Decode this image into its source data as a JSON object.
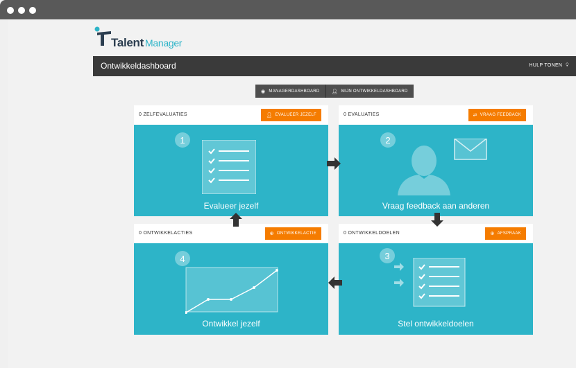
{
  "logo": {
    "brand": "Talent",
    "product": "Manager"
  },
  "header": {
    "title": "Ontwikkeldashboard",
    "help_label": "HULP TONEN"
  },
  "tabs": [
    {
      "label": "MANAGERDASHBOARD",
      "icon": "dashboard-icon"
    },
    {
      "label": "MIJN ONTWIKKELDASHBOARD",
      "icon": "user-icon"
    }
  ],
  "cards": {
    "self": {
      "count": "0 ZELFEVALUATIES",
      "button": "EVALUEER JEZELF",
      "step": "1",
      "label": "Evalueer jezelf"
    },
    "feedback": {
      "count": "0 EVALUATIES",
      "button": "VRAAG FEEDBACK",
      "step": "2",
      "label": "Vraag feedback aan anderen"
    },
    "actions": {
      "count": "0 ONTWIKKELACTIES",
      "button": "ONTWIKKELACTIE",
      "step": "4",
      "label": "Ontwikkel jezelf"
    },
    "goals": {
      "count": "0 ONTWIKKELDOELEN",
      "button": "AFSPRAAK",
      "step": "3",
      "label": "Stel ontwikkeldoelen"
    }
  },
  "colors": {
    "accent": "#2db4c8",
    "button": "#f57c00",
    "header": "#3a3a3a",
    "arrow": "#333333"
  }
}
